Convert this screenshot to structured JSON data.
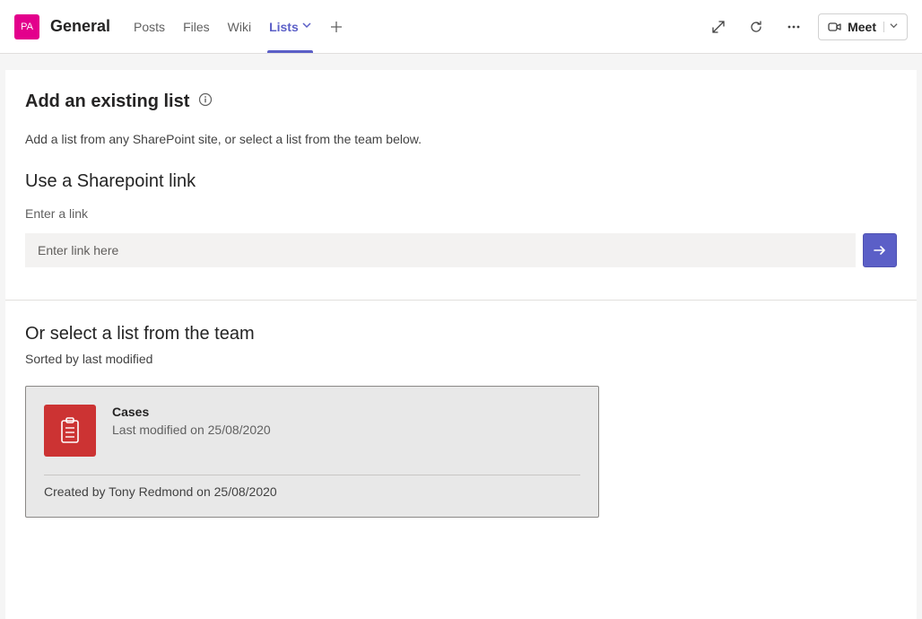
{
  "header": {
    "avatar_initials": "PA",
    "channel_name": "General",
    "tabs": [
      {
        "label": "Posts",
        "active": false
      },
      {
        "label": "Files",
        "active": false
      },
      {
        "label": "Wiki",
        "active": false
      },
      {
        "label": "Lists",
        "active": true,
        "dropdown": true
      }
    ],
    "meet_label": "Meet"
  },
  "page": {
    "title": "Add an existing list",
    "subtitle": "Add a list from any SharePoint site, or select a list from the team below.",
    "link_section_heading": "Use a Sharepoint link",
    "link_label": "Enter a link",
    "link_placeholder": "Enter link here",
    "select_heading": "Or select a list from the team",
    "sorted_text": "Sorted by last modified"
  },
  "lists": [
    {
      "name": "Cases",
      "modified": "Last modified on 25/08/2020",
      "created": "Created by Tony Redmond on 25/08/2020"
    }
  ]
}
